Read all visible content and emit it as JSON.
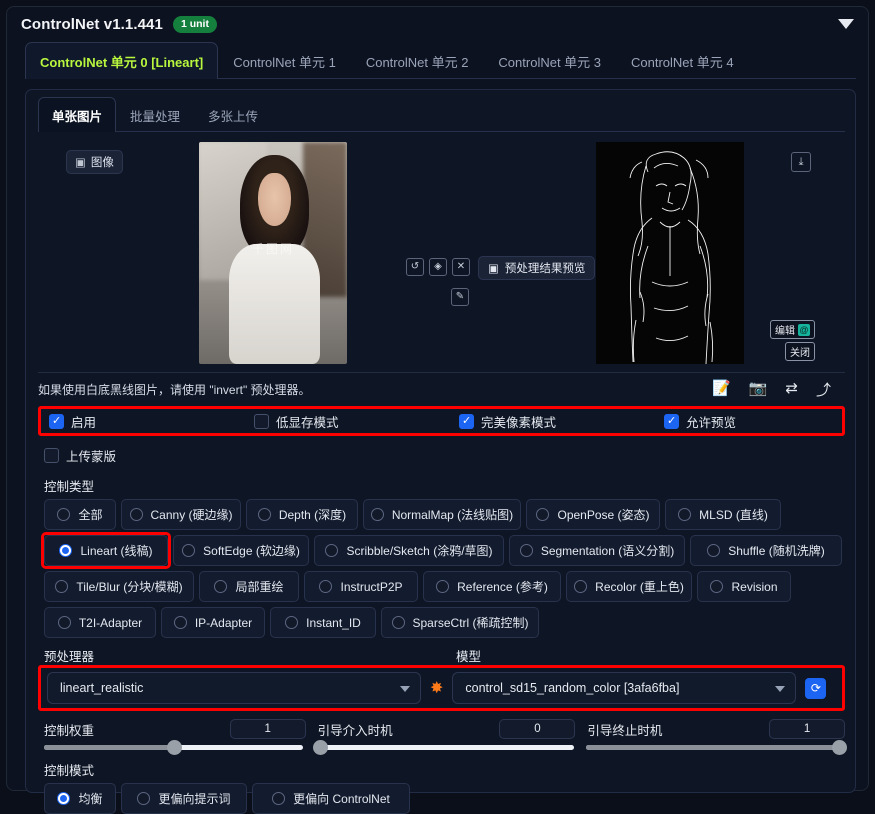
{
  "header": {
    "title": "ControlNet v1.1.441",
    "unit_badge": "1 unit",
    "collapse_icon": "chevron-down-icon"
  },
  "unit_tabs": [
    {
      "label": "ControlNet 单元 0 [Lineart]",
      "active": true
    },
    {
      "label": "ControlNet 单元 1",
      "active": false
    },
    {
      "label": "ControlNet 单元 2",
      "active": false
    },
    {
      "label": "ControlNet 单元 3",
      "active": false
    },
    {
      "label": "ControlNet 单元 4",
      "active": false
    }
  ],
  "source_tabs": [
    {
      "label": "单张图片",
      "active": true
    },
    {
      "label": "批量处理",
      "active": false
    },
    {
      "label": "多张上传",
      "active": false
    }
  ],
  "image_area": {
    "image_pill_label": "图像",
    "image_pill_icon": "image-icon",
    "watermark": "千图网",
    "tool_buttons": [
      {
        "icon": "undo-icon",
        "glyph": "↺"
      },
      {
        "icon": "eraser-icon",
        "glyph": "◈"
      },
      {
        "icon": "close-icon",
        "glyph": "✕"
      }
    ],
    "tool_buttons_row2": [
      {
        "icon": "brush-icon",
        "glyph": "✎"
      }
    ],
    "preview_pill_label": "预处理结果预览",
    "preview_pill_icon": "image-icon",
    "download_icon": "download-icon",
    "download_glyph": "⤓",
    "edit_label": "编辑",
    "edit_icon": "photopea-icon",
    "close_label": "关闭"
  },
  "hint": {
    "text": "如果使用白底黑线图片，请使用 \"invert\" 预处理器。",
    "icons": [
      {
        "name": "file-edit-icon",
        "glyph": "📝"
      },
      {
        "name": "camera-icon",
        "glyph": "📷"
      },
      {
        "name": "swap-icon",
        "glyph": "⇄"
      },
      {
        "name": "send-icon",
        "glyph": "⤴"
      }
    ]
  },
  "options": {
    "enable": {
      "label": "启用",
      "checked": true
    },
    "low_vram": {
      "label": "低显存模式",
      "checked": false
    },
    "pixel_perfect": {
      "label": "完美像素模式",
      "checked": true
    },
    "allow_preview": {
      "label": "允许预览",
      "checked": true
    },
    "upload_mask": {
      "label": "上传蒙版",
      "checked": false
    }
  },
  "control_type": {
    "label": "控制类型",
    "rows": [
      [
        {
          "label": "全部",
          "selected": false
        },
        {
          "label": "Canny (硬边缘)",
          "selected": false
        },
        {
          "label": "Depth (深度)",
          "selected": false
        },
        {
          "label": "NormalMap (法线贴图)",
          "selected": false
        },
        {
          "label": "OpenPose (姿态)",
          "selected": false
        },
        {
          "label": "MLSD (直线)",
          "selected": false
        }
      ],
      [
        {
          "label": "Lineart (线稿)",
          "selected": true
        },
        {
          "label": "SoftEdge (软边缘)",
          "selected": false
        },
        {
          "label": "Scribble/Sketch (涂鸦/草图)",
          "selected": false
        },
        {
          "label": "Segmentation (语义分割)",
          "selected": false
        },
        {
          "label": "Shuffle (随机洗牌)",
          "selected": false
        }
      ],
      [
        {
          "label": "Tile/Blur (分块/模糊)",
          "selected": false
        },
        {
          "label": "局部重绘",
          "selected": false
        },
        {
          "label": "InstructP2P",
          "selected": false
        },
        {
          "label": "Reference (参考)",
          "selected": false
        },
        {
          "label": "Recolor (重上色)",
          "selected": false
        },
        {
          "label": "Revision",
          "selected": false
        }
      ],
      [
        {
          "label": "T2I-Adapter",
          "selected": false
        },
        {
          "label": "IP-Adapter",
          "selected": false
        },
        {
          "label": "Instant_ID",
          "selected": false
        },
        {
          "label": "SparseCtrl (稀疏控制)",
          "selected": false
        }
      ]
    ]
  },
  "preprocessor": {
    "label": "预处理器",
    "value": "lineart_realistic",
    "run_icon": "spark-icon",
    "run_glyph": "✸"
  },
  "model": {
    "label": "模型",
    "value": "control_sd15_random_color [3afa6fba]",
    "refresh_icon": "refresh-icon",
    "refresh_glyph": "⟳"
  },
  "sliders": [
    {
      "label": "控制权重",
      "value": "1",
      "percent": 50
    },
    {
      "label": "引导介入时机",
      "value": "0",
      "percent": 0
    },
    {
      "label": "引导终止时机",
      "value": "1",
      "percent": 100
    }
  ],
  "control_mode": {
    "label": "控制模式",
    "options": [
      {
        "label": "均衡",
        "selected": true
      },
      {
        "label": "更偏向提示词",
        "selected": false
      },
      {
        "label": "更偏向 ControlNet",
        "selected": false
      }
    ]
  },
  "colors": {
    "accent_green": "#b9f73e",
    "badge_green": "#15803d",
    "checkbox_blue": "#1c64f2",
    "highlight_red": "#ff0000",
    "spark_orange": "#ff7a18"
  }
}
